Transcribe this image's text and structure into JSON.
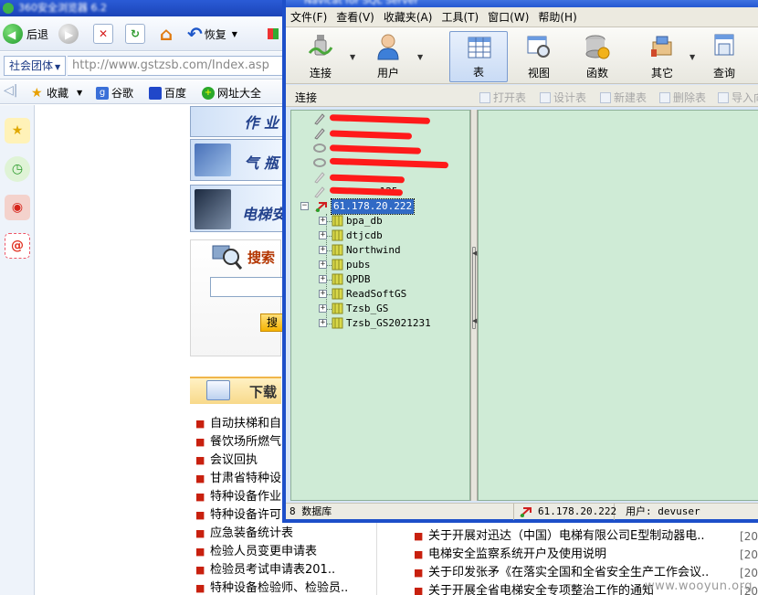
{
  "browser": {
    "nav": {
      "back_label": "后退",
      "restore_label": "恢复"
    },
    "address": {
      "group_label": "社会团体",
      "url": "http://www.gstzsb.com/Index.asp"
    },
    "favorites": [
      {
        "label": "收藏"
      },
      {
        "label": "谷歌"
      },
      {
        "label": "百度"
      },
      {
        "label": "网址大全"
      }
    ],
    "page": {
      "banners": [
        "作 业",
        "气 瓶",
        "电梯安"
      ],
      "search_title": "搜索",
      "search_button": "搜",
      "download_title": "下载",
      "left_list": [
        "自动扶梯和自",
        "餐饮场所燃气",
        "会议回执",
        "甘肃省特种设",
        "特种设备作业",
        "特种设备许可"
      ],
      "left_list2": [
        "应急装备统计表",
        "检验人员变更申请表",
        "检验员考试申请表201..",
        "特种设备检验师、检验员.."
      ],
      "right_list": [
        {
          "title": "关于开展对迅达（中国）电梯有限公司E型制动器电..",
          "year": "[20"
        },
        {
          "title": "电梯安全监察系统开户及使用说明",
          "year": "[20"
        },
        {
          "title": "关于印发张矛《在落实全国和全省安全生产工作会议..",
          "year": "[20"
        },
        {
          "title": "关于开展全省电梯安全专项整治工作的通知",
          "year": "[20"
        }
      ]
    }
  },
  "navicat": {
    "menu": [
      "文件(F)",
      "查看(V)",
      "收藏夹(A)",
      "工具(T)",
      "窗口(W)",
      "帮助(H)"
    ],
    "toolbar": [
      {
        "label": "连接",
        "icon": "connection-icon"
      },
      {
        "label": "用户",
        "icon": "user-icon"
      },
      {
        "label": "表",
        "icon": "table-icon",
        "active": true
      },
      {
        "label": "视图",
        "icon": "view-icon"
      },
      {
        "label": "函数",
        "icon": "function-icon"
      },
      {
        "label": "其它",
        "icon": "other-icon"
      },
      {
        "label": "查询",
        "icon": "query-icon"
      }
    ],
    "subbar": {
      "title": "连接",
      "actions": [
        "打开表",
        "设计表",
        "新建表",
        "删除表",
        "导入向"
      ]
    },
    "connections": {
      "selected": "61.178.20.222",
      "partial_visible": [
        ".125"
      ]
    },
    "databases": [
      "bpa_db",
      "dtjcdb",
      "Northwind",
      "pubs",
      "QPDB",
      "ReadSoftGS",
      "Tzsb_GS",
      "Tzsb_GS2021231"
    ],
    "status": {
      "count": "8 数据库",
      "connection": "61.178.20.222",
      "user": "用户: devuser"
    }
  },
  "watermark": "www.wooyun.org"
}
